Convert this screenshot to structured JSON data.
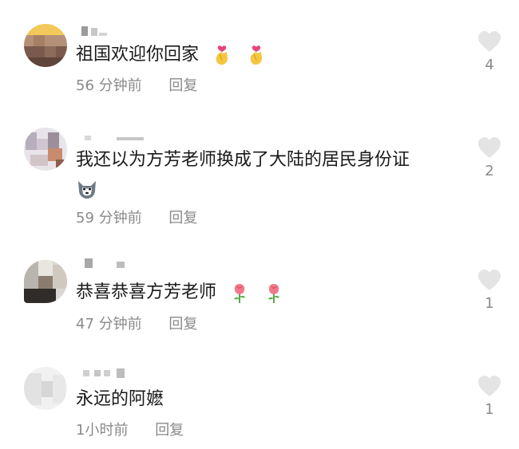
{
  "colors": {
    "text": "#1a1a1a",
    "meta": "#8a8a8a",
    "like_icon": "#e4e4e4",
    "background": "#ffffff"
  },
  "comments": [
    {
      "text": "祖国欢迎你回家",
      "time": "56 分钟前",
      "reply": "回复",
      "likes": "4",
      "emojis": [
        "crossed-fingers-heart-emoji",
        "crossed-fingers-heart-emoji"
      ]
    },
    {
      "text": "我还以为方芳老师换成了大陆的居民身份证",
      "time": "59 分钟前",
      "reply": "回复",
      "likes": "2",
      "emojis": [
        "husky-emoji"
      ]
    },
    {
      "text": "恭喜恭喜方芳老师",
      "time": "47 分钟前",
      "reply": "回复",
      "likes": "1",
      "emojis": [
        "rose-emoji",
        "rose-emoji"
      ]
    },
    {
      "text": "永远的阿嬷",
      "time": "1小时前",
      "reply": "回复",
      "likes": "1",
      "emojis": []
    }
  ]
}
